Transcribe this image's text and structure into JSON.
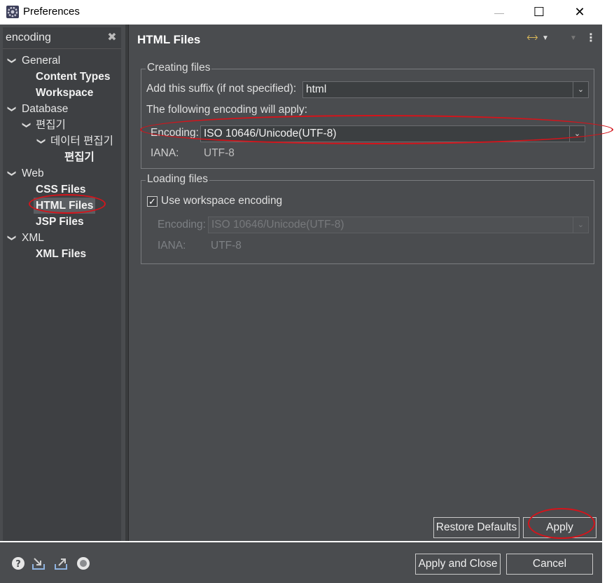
{
  "window": {
    "title": "Preferences",
    "minimize_glyph": "—",
    "maximize_glyph": "☐",
    "close_glyph": "✕"
  },
  "filter": {
    "value": "encoding",
    "clear_glyph": "✖"
  },
  "tree": [
    {
      "label": "General",
      "bold": false,
      "chevron": true
    },
    {
      "label": "Content Types",
      "bold": true,
      "chevron": false
    },
    {
      "label": "Workspace",
      "bold": true,
      "chevron": false
    },
    {
      "label": "Database",
      "bold": false,
      "chevron": true
    },
    {
      "label": "편집기",
      "bold": false,
      "chevron": true
    },
    {
      "label": "데이터 편집기",
      "bold": false,
      "chevron": true
    },
    {
      "label": "편집기",
      "bold": true,
      "chevron": false
    },
    {
      "label": "Web",
      "bold": false,
      "chevron": true
    },
    {
      "label": "CSS Files",
      "bold": true,
      "chevron": false
    },
    {
      "label": "HTML Files",
      "bold": true,
      "chevron": false,
      "selected": true
    },
    {
      "label": "JSP Files",
      "bold": true,
      "chevron": false
    },
    {
      "label": "XML",
      "bold": false,
      "chevron": true
    },
    {
      "label": "XML Files",
      "bold": true,
      "chevron": false
    }
  ],
  "page": {
    "title": "HTML Files",
    "creating": {
      "group_label": "Creating files",
      "suffix_label": "Add this suffix (if not specified):",
      "suffix_value": "html",
      "encoding_note": "The following encoding will apply:",
      "encoding_label": "Encoding:",
      "encoding_value": "ISO 10646/Unicode(UTF-8)",
      "iana_label": "IANA:",
      "iana_value": "UTF-8"
    },
    "loading": {
      "group_label": "Loading files",
      "checkbox_label": "Use workspace encoding",
      "checkbox_checked": true,
      "encoding_label": "Encoding:",
      "encoding_value": "ISO 10646/Unicode(UTF-8)",
      "iana_label": "IANA:",
      "iana_value": "UTF-8"
    }
  },
  "buttons": {
    "restore_defaults": "Restore Defaults",
    "apply": "Apply",
    "apply_and_close": "Apply and Close",
    "cancel": "Cancel"
  },
  "bottom_icons": [
    "help-icon",
    "import-icon",
    "export-icon",
    "record-icon"
  ],
  "colors": {
    "background": "#4a4c4f",
    "tree_background": "#3e4043",
    "annotation": "#d4141b"
  }
}
